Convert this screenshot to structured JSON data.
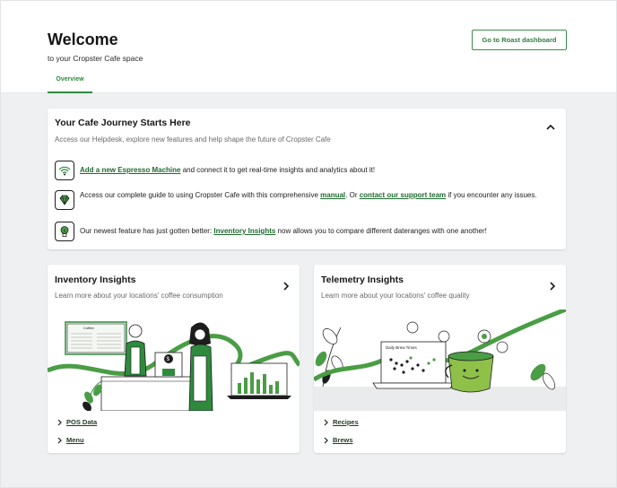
{
  "header": {
    "title": "Welcome",
    "subtitle": "to your Cropster Cafe space",
    "roast_button": "Go to Roast dashboard",
    "tabs": [
      {
        "label": "Overview",
        "active": true
      }
    ]
  },
  "journey": {
    "title": "Your Cafe Journey Starts Here",
    "subtitle": "Access our Helpdesk, explore new features and help shape the future of Cropster Cafe",
    "items": [
      {
        "icon": "wifi-signal-icon",
        "link1": "Add a new Espresso Machine",
        "text1": " and connect it to get real-time insights and analytics about it!"
      },
      {
        "icon": "diamond-icon",
        "text1": "Access our complete guide to using Cropster Cafe with this comprehensive ",
        "link1": "manual",
        "text2": ". Or ",
        "link2": "contact our support team",
        "text3": " if you encounter any issues."
      },
      {
        "icon": "lightbulb-icon",
        "text1": "Our newest feature has just gotten better: ",
        "link1": "Inventory Insights",
        "text2": " now allows you to compare different dateranges with one another!"
      }
    ]
  },
  "inventory": {
    "title": "Inventory Insights",
    "subtitle": "Learn more about your locations' coffee consumption",
    "board_label": "Coffee",
    "links": [
      "POS Data",
      "Menu"
    ]
  },
  "telemetry": {
    "title": "Telemetry Insights",
    "subtitle": "Learn more about your locations' coffee quality",
    "chart_label": "Daily Brew Times",
    "links": [
      "Recipes",
      "Brews"
    ]
  },
  "colors": {
    "accent_green": "#2f8a3e",
    "illustration_green": "#4a9d45",
    "link_dark_green": "#1f6b2f",
    "background": "#eef0f1"
  }
}
